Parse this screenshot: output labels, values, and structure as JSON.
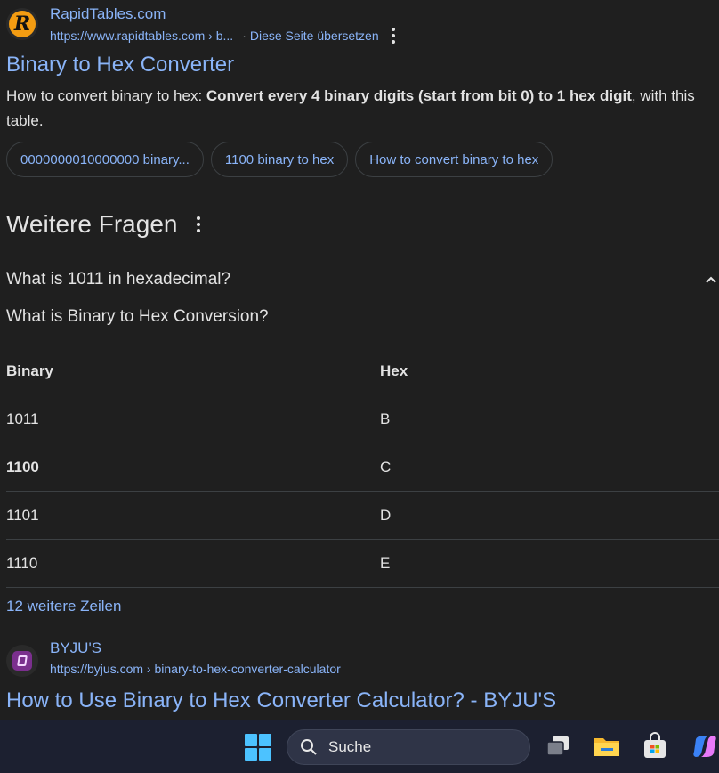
{
  "result1": {
    "site_name": "RapidTables.com",
    "url": "https://www.rapidtables.com › b...",
    "translate": "Diese Seite übersetzen",
    "title": "Binary to Hex Converter",
    "snippet_lead": "How to convert binary to hex: ",
    "snippet_bold": "Convert every 4 binary digits (start from bit 0) to 1 hex digit",
    "snippet_tail": ", with this table.",
    "chips": [
      "0000000010000000 binary...",
      "1100 binary to hex",
      "How to convert binary to hex"
    ]
  },
  "paa": {
    "heading": "Weitere Fragen",
    "question": "What is 1011 in hexadecimal?",
    "answer_heading": "What is Binary to Hex Conversion?",
    "table": {
      "headers": [
        "Binary",
        "Hex"
      ],
      "rows": [
        [
          "1011",
          "B"
        ],
        [
          "1100",
          "C"
        ],
        [
          "1101",
          "D"
        ],
        [
          "1110",
          "E"
        ]
      ]
    },
    "more_rows": "12 weitere Zeilen"
  },
  "result2": {
    "site_name": "BYJU'S",
    "url": "https://byjus.com › binary-to-hex-converter-calculator",
    "title": "How to Use Binary to Hex Converter Calculator? - BYJU'S"
  },
  "taskbar": {
    "search_label": "Suche",
    "icons": [
      "windows-start-icon",
      "search-icon",
      "task-view-icon",
      "file-explorer-icon",
      "microsoft-store-icon",
      "copilot-icon"
    ]
  },
  "colors": {
    "background": "#1f1f1f",
    "link": "#8ab4f8",
    "text": "#e3e3e3",
    "taskbar": "#1c2030"
  }
}
